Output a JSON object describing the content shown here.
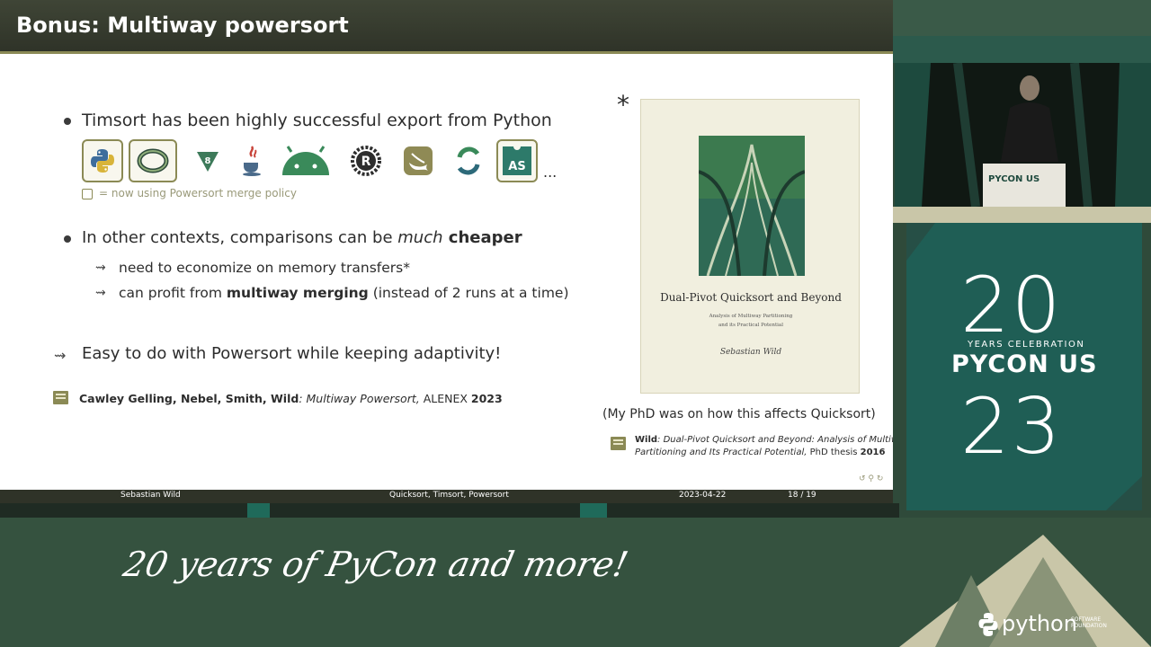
{
  "slide": {
    "title": "Bonus: Multiway powersort",
    "bullet1": "Timsort has been highly successful export from Python",
    "legend_note": "= now using Powersort merge policy",
    "logos_ellipsis": "...",
    "bullet2_prefix": "In other contexts, comparisons can be ",
    "bullet2_em": "much",
    "bullet2_strong": " cheaper",
    "sub1": "need to economize on memory transfers*",
    "sub2_prefix": "can profit from ",
    "sub2_strong": "multiway merging",
    "sub2_suffix": " (instead of 2 runs at a time)",
    "bottom_line": "Easy to do with Powersort while keeping adaptivity!",
    "cite_authors": "Cawley Gelling, Nebel, Smith, Wild",
    "cite_title": ": Multiway Powersort,",
    "cite_venue": " ALENEX ",
    "cite_year": "2023",
    "asterisk": "*",
    "book": {
      "title": "Dual-Pivot Quicksort and Beyond",
      "subtitle_line1": "Analysis of Multiway Partitioning",
      "subtitle_line2": "and its Practical Potential",
      "author": "Sebastian Wild"
    },
    "phd_note": "(My PhD was on how this affects Quicksort)",
    "cite2_author": "Wild",
    "cite2_line1": ": Dual-Pivot Quicksort and Beyond: Analysis of Multiway",
    "cite2_line2": "Partitioning and Its Practical Potential,",
    "cite2_line2_tail": " PhD thesis ",
    "cite2_year": "2016",
    "footer": {
      "author": "Sebastian Wild",
      "topic": "Quicksort, Timsort, Powersort",
      "date": "2023-04-22",
      "page": "18 / 19"
    }
  },
  "badge": {
    "top_num": "20",
    "years_celebration": "YEARS CELEBRATION",
    "pycon_us": "PYCON US",
    "bottom_num": "23"
  },
  "camera": {
    "podium_label": "PYCON US"
  },
  "tagline": "20 years of PyCon and more!",
  "psf_logo": {
    "word": "python",
    "sub": "SOFTWARE FOUNDATION"
  },
  "colors": {
    "slide_header": "#2f3328",
    "accent": "#8b8a55",
    "frame_green": "#2f4a3a",
    "badge_teal": "#1f5e55"
  }
}
